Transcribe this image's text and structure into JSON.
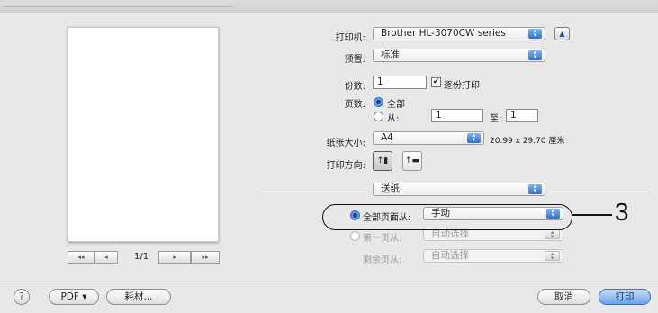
{
  "preview": {
    "page_indicator": "1/1"
  },
  "settings": {
    "printer_label": "打印机:",
    "printer_value": "Brother HL-3070CW series",
    "preset_label": "预置:",
    "preset_value": "标准",
    "copies_label": "份数:",
    "copies_value": "1",
    "collate_label": "逐份打印",
    "collate_checked": true,
    "pages_label": "页数:",
    "pages_all": "全部",
    "pages_from": "从:",
    "pages_from_value": "1",
    "pages_to": "至:",
    "pages_to_value": "1",
    "paper_size_label": "纸张大小:",
    "paper_size_value": "A4",
    "paper_size_dims": "20.99 x 29.70 厘米",
    "orientation_label": "打印方向:"
  },
  "panel": {
    "section_value": "送纸",
    "all_pages_from_label": "全部页面从:",
    "all_pages_from_value": "手动",
    "first_page_from_label": "第一页从:",
    "first_page_from_value": "自动选择",
    "remaining_from_label": "剩余页从:",
    "remaining_from_value": "自动选择"
  },
  "callout": {
    "number": "3"
  },
  "footer": {
    "help": "?",
    "pdf_label": "PDF ▾",
    "supplies_label": "耗材...",
    "cancel_label": "取消",
    "print_label": "打印"
  },
  "nav": {
    "first": "◂◂",
    "prev": "◂",
    "next": "▸",
    "last": "▸▸"
  }
}
